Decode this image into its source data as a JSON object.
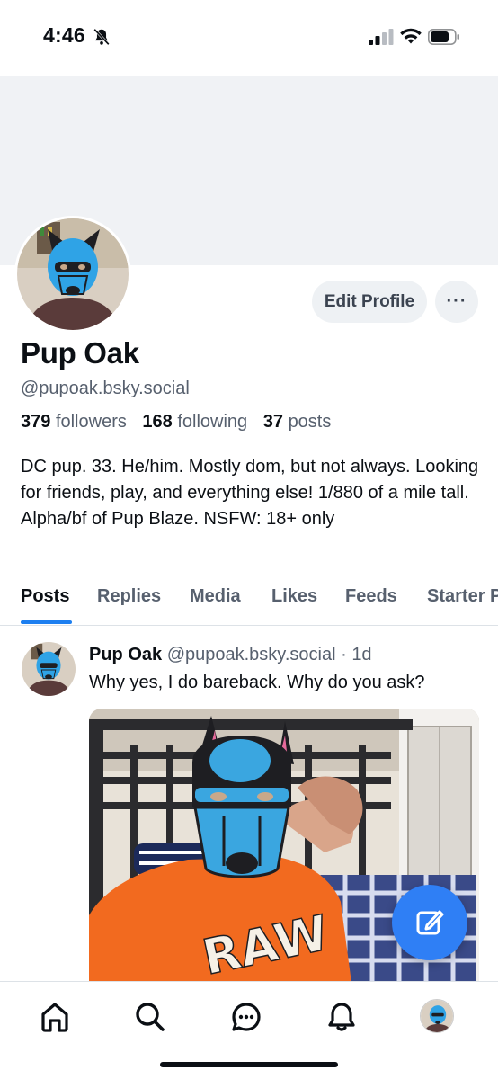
{
  "status_bar": {
    "time": "4:46",
    "icons": [
      "bell-muted-icon",
      "cellular-signal-icon",
      "wifi-icon",
      "battery-icon"
    ]
  },
  "profile": {
    "display_name": "Pup Oak",
    "handle": "@pupoak.bsky.social",
    "followers_count": "379",
    "followers_label": "followers",
    "following_count": "168",
    "following_label": "following",
    "posts_count": "37",
    "posts_label": "posts",
    "bio": "DC pup. 33. He/him. Mostly dom, but not always. Looking for friends, play, and everything else! 1/880 of a mile tall. Alpha/bf of Pup Blaze. NSFW: 18+ only",
    "edit_button": "Edit Profile",
    "more_button": "···"
  },
  "tabs": [
    {
      "label": "Posts",
      "active": true
    },
    {
      "label": "Replies",
      "active": false
    },
    {
      "label": "Media",
      "active": false
    },
    {
      "label": "Likes",
      "active": false
    },
    {
      "label": "Feeds",
      "active": false
    },
    {
      "label": "Starter P",
      "active": false
    }
  ],
  "post": {
    "author": "Pup Oak",
    "handle": "@pupoak.bsky.social",
    "separator": "·",
    "time": "1d",
    "text": "Why yes, I do bareback. Why do you ask?",
    "image_alt_icon": "photo-icon"
  },
  "bottom_nav": {
    "items": [
      "home-icon",
      "search-icon",
      "chat-icon",
      "notifications-bell-icon",
      "profile-avatar"
    ]
  },
  "colors": {
    "accent": "#1d7ff0",
    "fab": "#2f7ff5",
    "muted_text": "#57606e",
    "banner": "#f0f2f5",
    "mask_blue": "#3aa6e0",
    "shirt_orange": "#f26a1f"
  }
}
